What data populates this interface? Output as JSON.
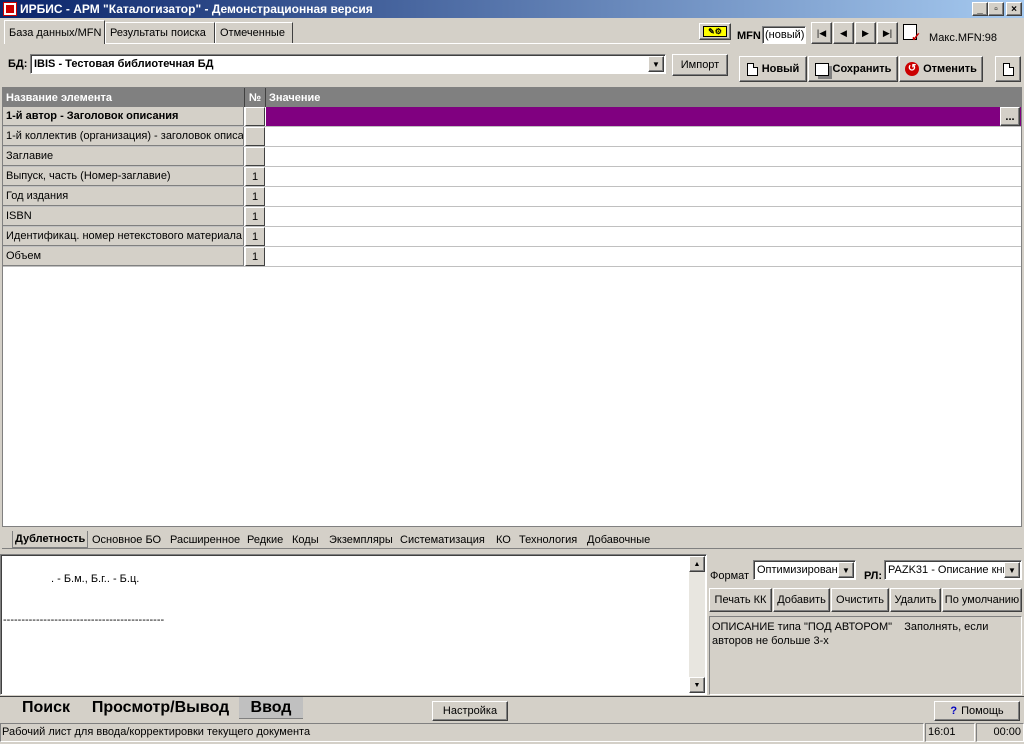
{
  "window": {
    "title": "ИРБИС - АРМ \"Каталогизатор\" - Демонстрационная версия",
    "min": "_",
    "max": "▫",
    "close": "×"
  },
  "tabs": [
    {
      "label": "База данных/MFN"
    },
    {
      "label": "Результаты поиска"
    },
    {
      "label": "Отмеченные"
    }
  ],
  "db": {
    "label": "БД:",
    "value": "IBIS - Тестовая библиотечная БД",
    "import_label": "Импорт"
  },
  "mfn": {
    "label": "MFN",
    "value": "(новый)",
    "max_label": "Макс.MFN:98"
  },
  "actions": {
    "new_label": "Новый",
    "save_label": "Сохранить",
    "cancel_label": "Отменить"
  },
  "grid": {
    "headers": {
      "name": "Название элемента",
      "num": "№",
      "value": "Значение"
    },
    "rows": [
      {
        "name": "1-й автор - Заголовок описания",
        "num": "",
        "value": "",
        "selected": true
      },
      {
        "name": "1-й коллектив (организация) - заголовок описа",
        "num": "",
        "value": ""
      },
      {
        "name": "Заглавие",
        "num": "",
        "value": ""
      },
      {
        "name": "Выпуск, часть (Номер-заглавие)",
        "num": "1",
        "value": ""
      },
      {
        "name": "Год издания",
        "num": "1",
        "value": ""
      },
      {
        "name": "ISBN",
        "num": "1",
        "value": ""
      },
      {
        "name": "Идентификац. номер нетекстового материала",
        "num": "1",
        "value": ""
      },
      {
        "name": "Объем",
        "num": "1",
        "value": ""
      }
    ],
    "ellipsis": "...",
    "selected_color": "#800080"
  },
  "subtabs": [
    "Дублетность",
    "Основное БО",
    "Расширенное",
    "Редкие",
    "Коды",
    "Экземпляры",
    "Систематизация",
    "КО",
    "Технология",
    "Добавочные"
  ],
  "preview": {
    "line1": ". - Б.м., Б.г.. - Б.ц.",
    "separator": "--------------------------------------------"
  },
  "format": {
    "label": "Формат",
    "value": "Оптимизирован",
    "rl_label": "РЛ:",
    "rl_value": "PAZK31 - Описание кни"
  },
  "format_buttons": [
    "Печать КК",
    "Добавить",
    "Очистить",
    "Удалить",
    "По умолчанию"
  ],
  "description": "ОПИСАНИЕ типа \"ПОД АВТОРОМ\"    Заполнять, если авторов не больше 3-х",
  "bottom_tabs": [
    "Поиск",
    "Просмотр/Вывод",
    "Ввод"
  ],
  "settings_label": "Настройка",
  "help_label": "Помощь",
  "status": {
    "text": "Рабочий лист для ввода/корректировки текущего документа",
    "cell1": "16:01",
    "cell2": "00:00"
  }
}
